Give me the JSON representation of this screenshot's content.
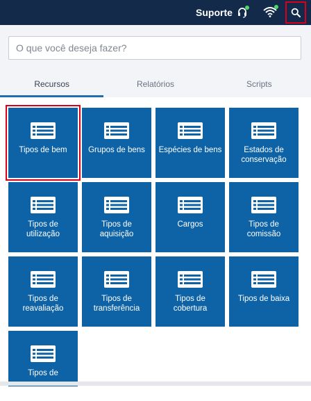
{
  "header": {
    "support_label": "Suporte",
    "support_icon": "headset-icon",
    "wifi_icon": "wifi-icon",
    "search_icon": "search-icon",
    "bg_color": "#132a4b",
    "status_dot_color": "#4cd964"
  },
  "search": {
    "placeholder": "O que você deseja fazer?",
    "value": ""
  },
  "tabs": [
    {
      "label": "Recursos",
      "active": true
    },
    {
      "label": "Relatórios",
      "active": false
    },
    {
      "label": "Scripts",
      "active": false
    }
  ],
  "tiles": [
    {
      "label": "Tipos de bem",
      "icon": "list-icon"
    },
    {
      "label": "Grupos de bens",
      "icon": "list-icon"
    },
    {
      "label": "Espécies de bens",
      "icon": "list-icon"
    },
    {
      "label": "Estados de conservação",
      "icon": "list-icon"
    },
    {
      "label": "Tipos de utilização",
      "icon": "list-icon"
    },
    {
      "label": "Tipos de aquisição",
      "icon": "list-icon"
    },
    {
      "label": "Cargos",
      "icon": "list-icon"
    },
    {
      "label": "Tipos de comissão",
      "icon": "list-icon"
    },
    {
      "label": "Tipos de reavaliação",
      "icon": "list-icon"
    },
    {
      "label": "Tipos de transferência",
      "icon": "list-icon"
    },
    {
      "label": "Tipos de cobertura",
      "icon": "list-icon"
    },
    {
      "label": "Tipos de baixa",
      "icon": "list-icon"
    },
    {
      "label": "Tipos de",
      "icon": "list-icon"
    }
  ],
  "colors": {
    "tile": "#0e63a6",
    "highlight": "#d9001b",
    "tab_active_underline": "#1f6fb0"
  }
}
